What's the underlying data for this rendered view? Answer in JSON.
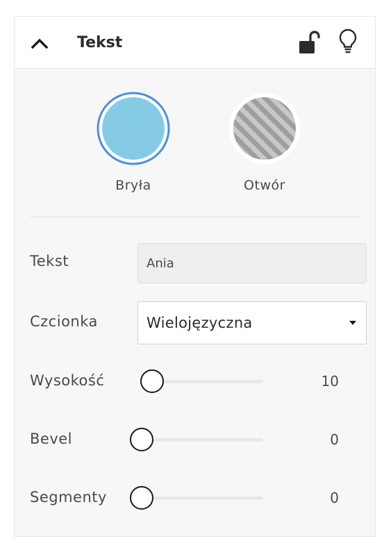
{
  "panel": {
    "title": "Tekst",
    "icons": {
      "collapse": "chevron-up-icon",
      "lock": "unlocked-padlock-icon",
      "visibility": "lightbulb-icon"
    }
  },
  "modes": [
    {
      "label": "Bryła",
      "selected": true,
      "color": "#86cbe6"
    },
    {
      "label": "Otwór",
      "selected": false,
      "color": "#a8a8a8"
    }
  ],
  "colors": {
    "selection_ring": "#4d8fd9"
  },
  "fields": {
    "text_label": "Tekst",
    "text_value": "Ania",
    "font_label": "Czcionka",
    "font_value": "Wielojęzyczna"
  },
  "sliders": [
    {
      "label": "Wysokość",
      "value": "10"
    },
    {
      "label": "Bevel",
      "value": "0"
    },
    {
      "label": "Segmenty",
      "value": "0"
    }
  ]
}
